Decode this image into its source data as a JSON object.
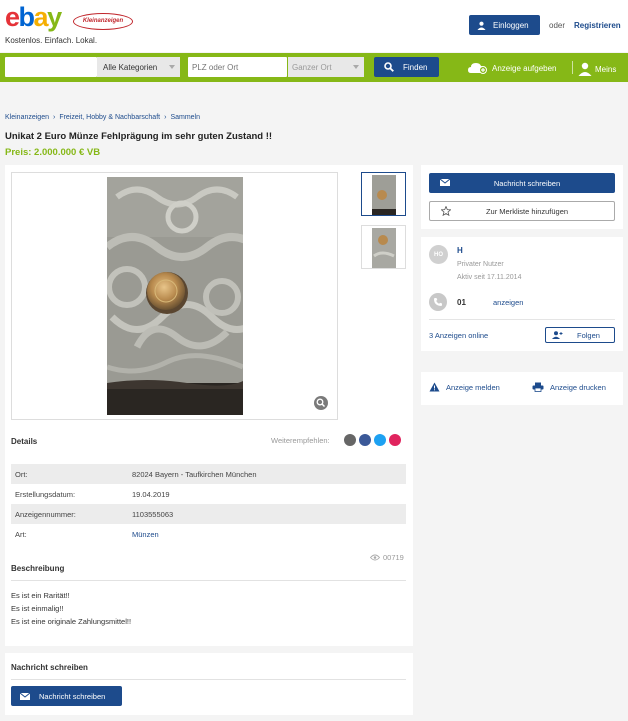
{
  "header": {
    "logo_text": "ebay",
    "logo_badge": "Kleinanzeigen",
    "tagline": "Kostenlos. Einfach. Lokal.",
    "login_label": "Einloggen",
    "or_label": "oder",
    "register_label": "Registrieren"
  },
  "search": {
    "query_value": "",
    "category_value": "Alle Kategorien",
    "location_placeholder": "PLZ oder Ort",
    "radius_value": "Ganzer Ort",
    "submit_label": "Finden",
    "post_ad_label": "Anzeige aufgeben",
    "my_label": "Meins"
  },
  "breadcrumb": [
    "Kleinanzeigen",
    "Freizeit, Hobby & Nachbarschaft",
    "Sammeln"
  ],
  "ad": {
    "title": "Unikat 2 Euro Münze Fehlprägung im sehr guten Zustand !!",
    "price": "Preis: 2.000.000 € VB"
  },
  "details": {
    "heading": "Details",
    "share_label": "Weiterempfehlen:",
    "rows": [
      {
        "key": "Ort:",
        "value": "82024 Bayern - Taufkirchen München"
      },
      {
        "key": "Erstellungsdatum:",
        "value": "19.04.2019"
      },
      {
        "key": "Anzeigennummer:",
        "value": "1103555063"
      },
      {
        "key": "Art:",
        "value": "Münzen"
      }
    ],
    "views": "00719"
  },
  "description": {
    "heading": "Beschreibung",
    "lines": [
      "Es ist ein Rarität!!",
      "Es ist einmalig!!",
      "Es ist eine originale Zahlungsmittel!!"
    ]
  },
  "message_card": {
    "heading": "Nachricht schreiben",
    "button_label": "Nachricht schreiben"
  },
  "actions": {
    "message_label": "Nachricht schreiben",
    "watchlist_label": "Zur Merkliste hinzufügen"
  },
  "seller": {
    "initials": "HO",
    "name": "H",
    "type": "Privater Nutzer",
    "since": "Aktiv seit 17.11.2014",
    "phone": "01",
    "phone_show": "anzeigen",
    "ads_online": "3 Anzeigen online",
    "follow_label": "Folgen"
  },
  "footer_actions": {
    "report_label": "Anzeige melden",
    "print_label": "Anzeige drucken"
  },
  "colors": {
    "brand_green": "#86b817",
    "primary_blue": "#1d4b8c",
    "ebay_red": "#e53238",
    "ebay_blue": "#0064d2",
    "ebay_yellow": "#f5af02"
  },
  "icons": [
    "user-icon",
    "search-icon",
    "camera-plus-icon",
    "person-icon",
    "envelope-icon",
    "star-icon",
    "phone-icon",
    "follow-icon",
    "warning-icon",
    "printer-icon",
    "zoom-icon",
    "eye-icon",
    "mail-share-icon",
    "facebook-icon",
    "twitter-icon",
    "pinterest-icon"
  ]
}
